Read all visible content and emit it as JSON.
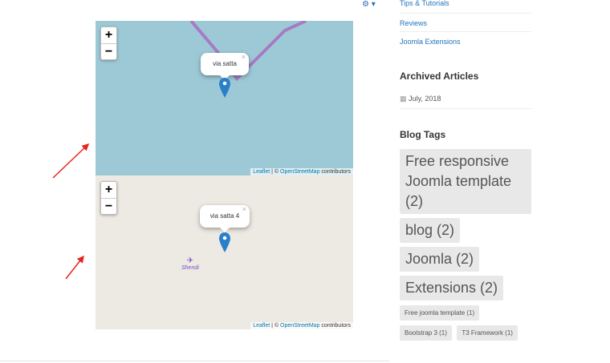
{
  "toolbar": {
    "gear_icon": "gear-icon"
  },
  "maps": [
    {
      "popup": "via satta",
      "close": "×",
      "attribution": {
        "leaflet": "Leaflet",
        "sep": " | © ",
        "osm": "OpenStreetMap",
        "contrib": " contributors"
      }
    },
    {
      "popup": "via satta 4",
      "close": "×",
      "place": "Shendi",
      "attribution": {
        "leaflet": "Leaflet",
        "sep": " | © ",
        "osm": "OpenStreetMap",
        "contrib": " contributors"
      }
    }
  ],
  "zoom": {
    "in": "+",
    "out": "−"
  },
  "sidebar": {
    "categories": [
      "Tips & Tutorials",
      "Reviews",
      "Joomla Extensions"
    ],
    "archived_title": "Archived Articles",
    "archived": [
      {
        "label": "July, 2018"
      }
    ],
    "tags_title": "Blog Tags",
    "big_tags": [
      "Free responsive Joomla template (2)",
      "blog (2)",
      "Joomla (2)",
      "Extensions (2)"
    ],
    "small_tags": [
      "Free joomla template (1)",
      "Bootstrap 3 (1)",
      "T3 Framework (1)"
    ]
  },
  "colors": {
    "accent": "#1e73be",
    "annotation": "#e8231f",
    "water": "#9dc9d6",
    "land": "#ede9e3"
  }
}
